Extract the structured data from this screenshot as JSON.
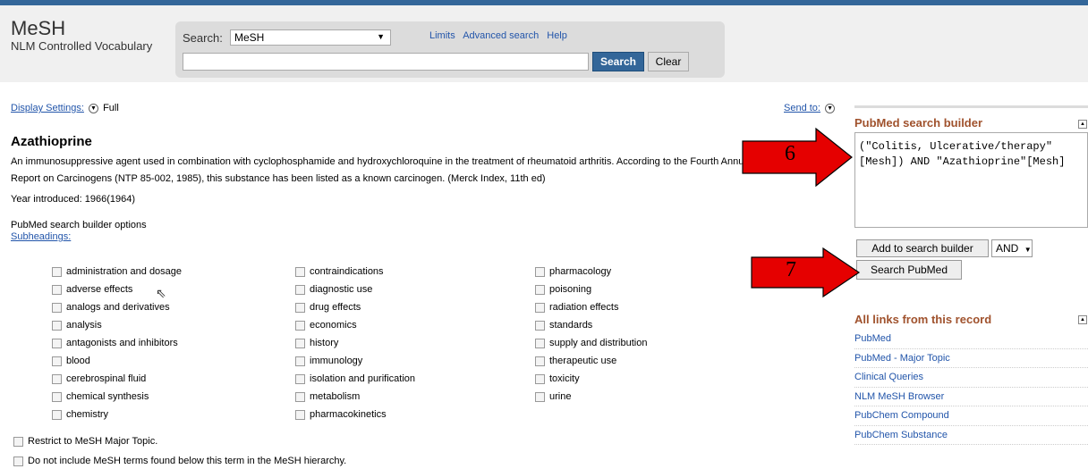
{
  "header": {
    "title": "MeSH",
    "subtitle": "NLM Controlled Vocabulary",
    "search_label": "Search:",
    "db_selected": "MeSH",
    "links": [
      "Limits",
      "Advanced search",
      "Help"
    ],
    "search_button": "Search",
    "clear_button": "Clear"
  },
  "toolbar": {
    "display_settings": "Display Settings:",
    "display_value": "Full",
    "send_to": "Send to:"
  },
  "record": {
    "title": "Azathioprine",
    "description": "An immunosuppressive agent used in combination with cyclophosphamide and hydroxychloroquine in the treatment of rheumatoid arthritis. According to the Fourth Annual Report on Carcinogens (NTP 85-002, 1985), this substance has been listed as a known carcinogen. (Merck Index, 11th ed)",
    "year": "Year introduced: 1966(1964)",
    "builder_options": "PubMed search builder options",
    "subheadings_label": "Subheadings:"
  },
  "subheadings": {
    "col1": [
      "administration and dosage",
      "adverse effects",
      "analogs and derivatives",
      "analysis",
      "antagonists and inhibitors",
      "blood",
      "cerebrospinal fluid",
      "chemical synthesis",
      "chemistry"
    ],
    "col2": [
      "contraindications",
      "diagnostic use",
      "drug effects",
      "economics",
      "history",
      "immunology",
      "isolation and purification",
      "metabolism",
      "pharmacokinetics"
    ],
    "col3": [
      "pharmacology",
      "poisoning",
      "radiation effects",
      "standards",
      "supply and distribution",
      "therapeutic use",
      "toxicity",
      "urine"
    ]
  },
  "options": {
    "restrict": "Restrict to MeSH Major Topic.",
    "no_explode": "Do not include MeSH terms found below this term in the MeSH hierarchy."
  },
  "builder": {
    "title": "PubMed search builder",
    "query_line1": "(\"Colitis, Ulcerative/therapy\"",
    "query_line2": "[Mesh]) AND \"Azathioprine\"[Mesh]",
    "add_button": "Add to search builder",
    "operator": "AND",
    "search_button": "Search PubMed"
  },
  "links_panel": {
    "title": "All links from this record",
    "items": [
      "PubMed",
      "PubMed - Major Topic",
      "Clinical Queries",
      "NLM MeSH Browser",
      "PubChem Compound",
      "PubChem Substance"
    ]
  },
  "annotations": {
    "arrow6": "6",
    "arrow7": "7",
    "color": "#e50000"
  }
}
